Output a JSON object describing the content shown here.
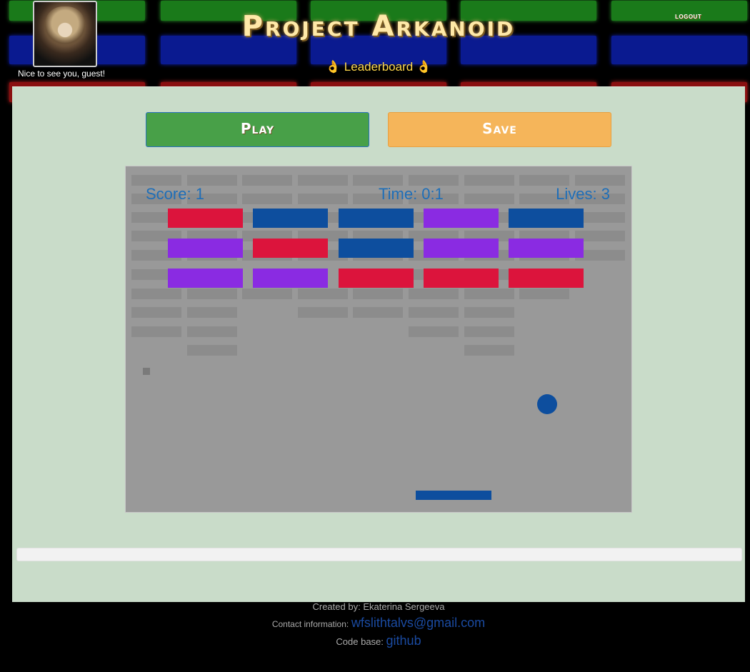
{
  "header": {
    "title": "Project Arkanoid",
    "greeting": "Nice to see you, guest!",
    "leaderboard_label": "👌 Leaderboard 👌",
    "logout_label": "logout"
  },
  "controls": {
    "play_label": "Play",
    "save_label": "Save"
  },
  "game": {
    "score_text": "Score: 1",
    "time_text": "Time: 0:1",
    "lives_text": "Lives: 3",
    "brick_colors": {
      "red": "#dc143c",
      "blue": "#0d4e9e",
      "purple": "#8a2be2"
    },
    "brick_rows": [
      [
        "red",
        "blue",
        "blue",
        "purple",
        "blue"
      ],
      [
        "purple",
        "red",
        "blue",
        "purple",
        "purple"
      ],
      [
        "purple",
        "purple",
        "red",
        "red",
        "red"
      ]
    ],
    "ball_color": "#0d4e9e",
    "paddle_color": "#0d4e9e"
  },
  "footer": {
    "created_label": "Created by:",
    "author": "Ekaterina Sergeeva",
    "contact_label": "Contact information:",
    "email": "wfslithtalvs@gmail.com",
    "codebase_label": "Code base:",
    "codebase_link": "github"
  }
}
